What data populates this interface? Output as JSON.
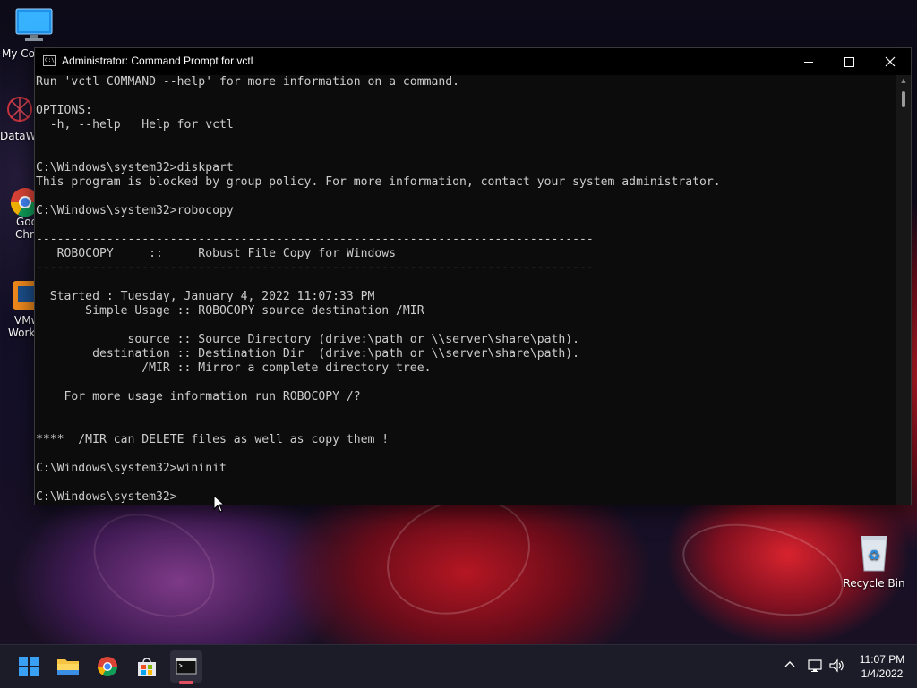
{
  "window": {
    "title": "Administrator: Command Prompt for vctl",
    "icon": "cmd-icon",
    "buttons": [
      "minimize-icon",
      "maximize-icon",
      "close-icon"
    ]
  },
  "console": {
    "lines": [
      "Run 'vctl COMMAND --help' for more information on a command.",
      "",
      "OPTIONS:",
      "  -h, --help   Help for vctl",
      "",
      "",
      "C:\\Windows\\system32>diskpart",
      "This program is blocked by group policy. For more information, contact your system administrator.",
      "",
      "C:\\Windows\\system32>robocopy",
      "",
      "-------------------------------------------------------------------------------",
      "   ROBOCOPY     ::     Robust File Copy for Windows",
      "-------------------------------------------------------------------------------",
      "",
      "  Started : Tuesday, January 4, 2022 11:07:33 PM",
      "       Simple Usage :: ROBOCOPY source destination /MIR",
      "",
      "             source :: Source Directory (drive:\\path or \\\\server\\share\\path).",
      "        destination :: Destination Dir  (drive:\\path or \\\\server\\share\\path).",
      "               /MIR :: Mirror a complete directory tree.",
      "",
      "    For more usage information run ROBOCOPY /?",
      "",
      "",
      "****  /MIR can DELETE files as well as copy them !",
      "",
      "C:\\Windows\\system32>wininit",
      "",
      "C:\\Windows\\system32>"
    ]
  },
  "desktop": {
    "icons": [
      {
        "label": "My Co",
        "icon": "computer-icon"
      },
      {
        "label": "DataW",
        "icon": "datawarrior-icon"
      },
      {
        "label": "Goo",
        "label2": "Chro",
        "icon": "chrome-icon"
      },
      {
        "label": "VMw",
        "label2": "Works",
        "icon": "vmware-icon"
      },
      {
        "label": "Recycle Bin",
        "icon": "recycle-bin-icon"
      }
    ]
  },
  "taskbar": {
    "apps": [
      "windows-start-icon",
      "file-explorer-icon",
      "chrome-icon",
      "store-icon",
      "terminal-icon"
    ],
    "tray": {
      "time": "11:07 PM",
      "date": "1/4/2022",
      "icons": [
        "chevron-up-icon",
        "network-icon",
        "volume-icon"
      ]
    }
  },
  "colors": {
    "console_bg": "#0c0c0c",
    "console_fg": "#cccccc",
    "titlebar_bg": "#000000",
    "taskbar_bg": "#1c1c28",
    "accent": "#e05060"
  }
}
